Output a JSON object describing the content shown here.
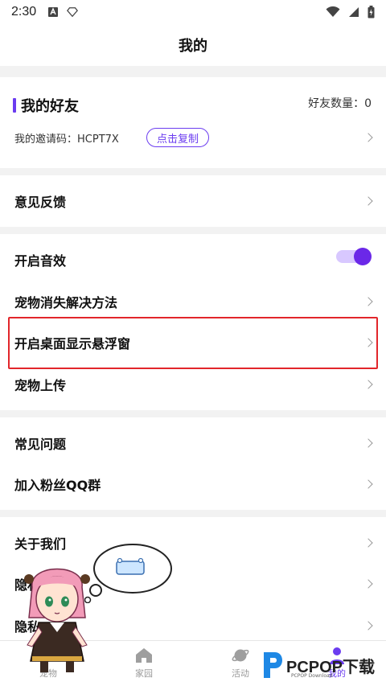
{
  "status": {
    "time": "2:30"
  },
  "header": {
    "title": "我的"
  },
  "friends": {
    "title": "我的好友",
    "count_label": "好友数量：0",
    "invite_label": "我的邀请码：HCPT7X",
    "copy_button": "点击复制"
  },
  "menu": {
    "feedback": "意见反馈",
    "sound": "开启音效",
    "sound_enabled": true,
    "pet_missing": "宠物消失解决方法",
    "floating_window": "开启桌面显示悬浮窗",
    "pet_upload": "宠物上传",
    "faq": "常见问题",
    "qq_group": "加入粉丝QQ群",
    "about": "关于我们",
    "privacy": "隐私政策",
    "hidden": "隐私"
  },
  "tabs": [
    {
      "label": "宠物"
    },
    {
      "label": "家园"
    },
    {
      "label": "活动"
    },
    {
      "label": "我的"
    }
  ],
  "watermark": {
    "text": "PCPOP下载",
    "sub": "PCPOP Download"
  },
  "colors": {
    "accent": "#6b3cf0",
    "highlight": "#e2262b"
  }
}
